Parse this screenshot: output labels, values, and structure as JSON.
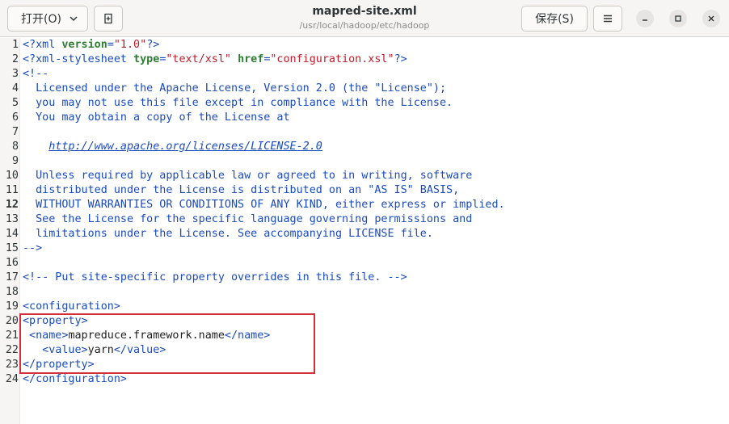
{
  "header": {
    "open_label": "打开(O)",
    "save_label": "保存(S)",
    "title": "mapred-site.xml",
    "subtitle": "/usr/local/hadoop/etc/hadoop"
  },
  "editor": {
    "current_line": 12,
    "line_numbers": [
      "1",
      "2",
      "3",
      "4",
      "5",
      "6",
      "7",
      "8",
      "9",
      "10",
      "11",
      "12",
      "13",
      "14",
      "15",
      "16",
      "17",
      "18",
      "19",
      "20",
      "21",
      "22",
      "23",
      "24"
    ],
    "lines": [
      [
        {
          "t": "tag",
          "v": "<?xml "
        },
        {
          "t": "attr",
          "v": "version"
        },
        {
          "t": "tag",
          "v": "="
        },
        {
          "t": "str",
          "v": "\"1.0\""
        },
        {
          "t": "tag",
          "v": "?>"
        }
      ],
      [
        {
          "t": "tag",
          "v": "<?xml-stylesheet "
        },
        {
          "t": "attr",
          "v": "type"
        },
        {
          "t": "tag",
          "v": "="
        },
        {
          "t": "str",
          "v": "\"text/xsl\""
        },
        {
          "t": "tag",
          "v": " "
        },
        {
          "t": "attr",
          "v": "href"
        },
        {
          "t": "tag",
          "v": "="
        },
        {
          "t": "str",
          "v": "\"configuration.xsl\""
        },
        {
          "t": "tag",
          "v": "?>"
        }
      ],
      [
        {
          "t": "cmt",
          "v": "<!--"
        }
      ],
      [
        {
          "t": "cmt",
          "v": "  Licensed under the Apache License, Version 2.0 (the \"License\");"
        }
      ],
      [
        {
          "t": "cmt",
          "v": "  you may not use this file except in compliance with the License."
        }
      ],
      [
        {
          "t": "cmt",
          "v": "  You may obtain a copy of the License at"
        }
      ],
      [],
      [
        {
          "t": "cmt",
          "v": "    "
        },
        {
          "t": "link",
          "v": "http://www.apache.org/licenses/LICENSE-2.0"
        }
      ],
      [],
      [
        {
          "t": "cmt",
          "v": "  Unless required by applicable law or agreed to in writing, software"
        }
      ],
      [
        {
          "t": "cmt",
          "v": "  distributed under the License is distributed on an \"AS IS\" BASIS,"
        }
      ],
      [
        {
          "t": "cmt",
          "v": "  WITHOUT WARRANTIES OR CONDITIONS OF ANY KIND, either express or implied."
        }
      ],
      [
        {
          "t": "cmt",
          "v": "  See the License for the specific language governing permissions and"
        }
      ],
      [
        {
          "t": "cmt",
          "v": "  limitations under the License. See accompanying LICENSE file."
        }
      ],
      [
        {
          "t": "cmt",
          "v": "-->"
        }
      ],
      [],
      [
        {
          "t": "cmt",
          "v": "<!-- Put site-specific property overrides in this file. -->"
        }
      ],
      [],
      [
        {
          "t": "tag",
          "v": "<configuration>"
        }
      ],
      [
        {
          "t": "tag",
          "v": "<property>"
        }
      ],
      [
        {
          "t": "tag",
          "v": " <name>"
        },
        {
          "t": "text",
          "v": "mapreduce.framework.name"
        },
        {
          "t": "tag",
          "v": "</name>"
        }
      ],
      [
        {
          "t": "tag",
          "v": "   <value>"
        },
        {
          "t": "text",
          "v": "yarn"
        },
        {
          "t": "tag",
          "v": "</value>"
        }
      ],
      [
        {
          "t": "tag",
          "v": "</property>"
        }
      ],
      [
        {
          "t": "tag",
          "v": "</configuration>"
        }
      ]
    ]
  },
  "icons": {
    "open_chevron": "chevron-down-icon",
    "new_tab": "new-tab-icon",
    "menu": "hamburger-menu-icon",
    "minimize": "minimize-icon",
    "maximize": "maximize-icon",
    "close": "close-icon"
  },
  "colors": {
    "annotation_box": "#d32f3b",
    "comment": "#1a4bbd",
    "attribute": "#2e7d32",
    "string": "#c01c28"
  }
}
